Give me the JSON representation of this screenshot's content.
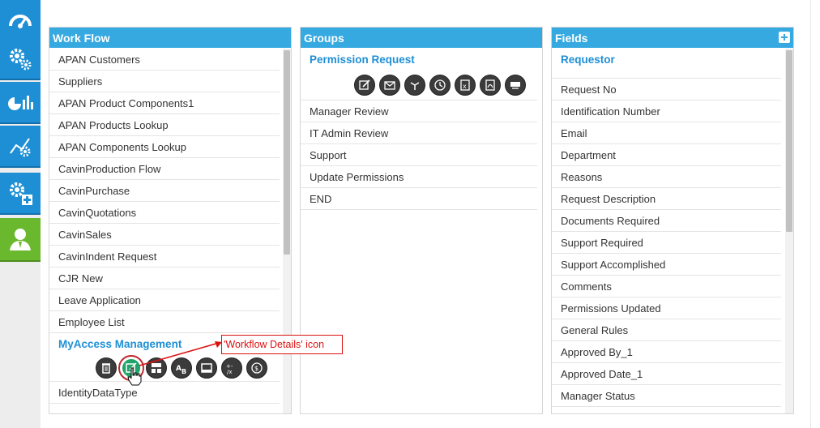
{
  "colors": {
    "nav_blue": "#1e8fd5",
    "nav_active": "#6ab82e",
    "header": "#36a9e1",
    "link": "#1e8fd5",
    "annotation": "#dd1111"
  },
  "leftnav": {
    "items": [
      {
        "icon": "dashboard-gauge-icon"
      },
      {
        "icon": "gears-icon"
      },
      {
        "icon": "analytics-chart-icon"
      },
      {
        "icon": "workflow-graph-icon"
      },
      {
        "icon": "gears-add-icon"
      },
      {
        "icon": "user-icon",
        "active": true
      }
    ]
  },
  "workflow": {
    "title": "Work Flow",
    "items": [
      "APAN Customers",
      "Suppliers",
      "APAN Product Components1",
      "APAN Products Lookup",
      "APAN Components Lookup",
      "CavinProduction Flow",
      "CavinPurchase",
      "CavinQuotations",
      "CavinSales",
      "CavinIndent Request",
      "CJR New",
      "Leave Application",
      "Employee List"
    ],
    "selected": "MyAccess Management",
    "selected_actions": [
      "trash-icon",
      "workflow-details-icon",
      "layout-icon",
      "ab-text-icon",
      "form-icon",
      "calculator-icon",
      "currency-icon"
    ],
    "after_selected": [
      "IdentityDataType"
    ]
  },
  "groups": {
    "title": "Groups",
    "selected": "Permission Request",
    "selected_actions": [
      "edit-icon",
      "mail-icon",
      "split-arrow-icon",
      "clock-icon",
      "excel-icon",
      "pdf-icon",
      "print-icon"
    ],
    "items": [
      "Manager Review",
      "IT Admin Review",
      "Support",
      "Update Permissions",
      "END"
    ]
  },
  "fields": {
    "title": "Fields",
    "selected": "Requestor",
    "items": [
      "Request No",
      "Identification Number",
      "Email",
      "Department",
      "Reasons",
      "Request Description",
      "Documents Required",
      "Support Required",
      "Support Accomplished",
      "Comments",
      "Permissions Updated",
      "General Rules",
      "Approved By_1",
      "Approved Date_1",
      "Manager Status"
    ]
  },
  "annotation": {
    "text": "'Workflow Details' icon"
  }
}
